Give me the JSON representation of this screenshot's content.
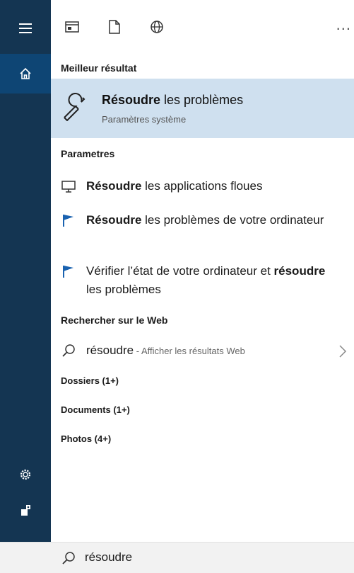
{
  "colors": {
    "sidebar": "#143552",
    "sidebar_active": "#0e4574",
    "best_highlight": "#cfe0ef"
  },
  "sidebar": {
    "items": [
      {
        "icon": "hamburger-menu-icon"
      },
      {
        "icon": "home-icon",
        "active": true
      },
      {
        "icon": "settings-gear-icon"
      },
      {
        "icon": "feedback-icon"
      }
    ]
  },
  "toolbar": {
    "filters": [
      {
        "icon": "apps-filter-icon"
      },
      {
        "icon": "documents-filter-icon"
      },
      {
        "icon": "web-filter-icon"
      }
    ],
    "more_label": "..."
  },
  "sections": {
    "best_match": "Meilleur résultat",
    "settings": "Parametres",
    "web": "Rechercher sur le Web",
    "folders": "Dossiers (1+)",
    "documents": "Documents (1+)",
    "photos": "Photos (4+)"
  },
  "best_result": {
    "title_bold": "Résoudre",
    "title_rest": " les problèmes",
    "subtitle": "Paramètres système",
    "icon": "wrench-icon"
  },
  "settings_results": [
    {
      "icon": "monitor-icon",
      "parts": [
        {
          "b": "Résoudre"
        },
        {
          "t": " les applications floues"
        }
      ]
    },
    {
      "icon": "flag-icon",
      "parts": [
        {
          "b": "Résoudre"
        },
        {
          "t": " les problèmes de votre ordinateur"
        }
      ]
    },
    {
      "icon": "flag-icon",
      "parts": [
        {
          "t": "Vérifier l’état de votre ordinateur et "
        },
        {
          "b": "résoudre"
        },
        {
          "t": " les problèmes"
        }
      ]
    }
  ],
  "web_result": {
    "query": "résoudre",
    "suffix": " - Afficher les résultats Web"
  },
  "search_box": {
    "value": "résoudre"
  }
}
